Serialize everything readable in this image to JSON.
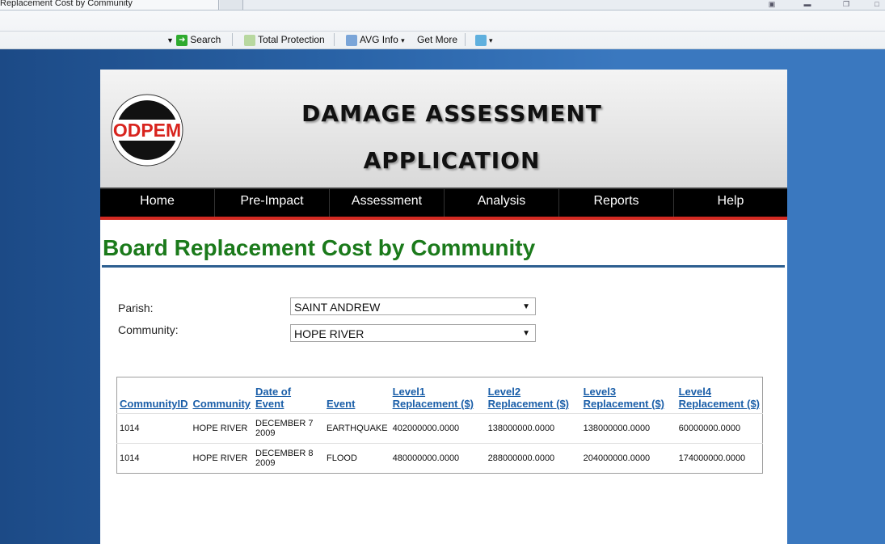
{
  "browser": {
    "tab_title": "Replacement Cost by Community",
    "toolbar": {
      "search_label": "Search",
      "total_protection_label": "Total Protection",
      "avg_info_label": "AVG Info",
      "get_more_label": "Get More"
    }
  },
  "header": {
    "logo_text": "ODPEM",
    "app_title_line1": "DAMAGE ASSESSMENT",
    "app_title_line2": "APPLICATION"
  },
  "nav": {
    "items": [
      "Home",
      "Pre-Impact",
      "Assessment",
      "Analysis",
      "Reports",
      "Help"
    ]
  },
  "main": {
    "title": "Board Replacement Cost by Community",
    "filters": {
      "parish_label": "Parish:",
      "parish_value": "SAINT ANDREW",
      "community_label": "Community:",
      "community_value": "HOPE RIVER"
    },
    "table": {
      "headers": [
        "CommunityID",
        "Community",
        "Date of Event",
        "Event",
        "Level1 Replacement ($)",
        "Level2 Replacement ($)",
        "Level3 Replacement ($)",
        "Level4 Replacement ($)"
      ],
      "rows": [
        [
          "1014",
          "HOPE RIVER",
          "DECEMBER 7 2009",
          "EARTHQUAKE",
          "402000000.0000",
          "138000000.0000",
          "138000000.0000",
          "60000000.0000"
        ],
        [
          "1014",
          "HOPE RIVER",
          "DECEMBER 8 2009",
          "FLOOD",
          "480000000.0000",
          "288000000.0000",
          "204000000.0000",
          "174000000.0000"
        ]
      ]
    }
  },
  "colors": {
    "title_green": "#1b7a1b",
    "nav_bg": "#000000",
    "nav_accent": "#d32a22",
    "link_blue": "#1a5ea8"
  }
}
